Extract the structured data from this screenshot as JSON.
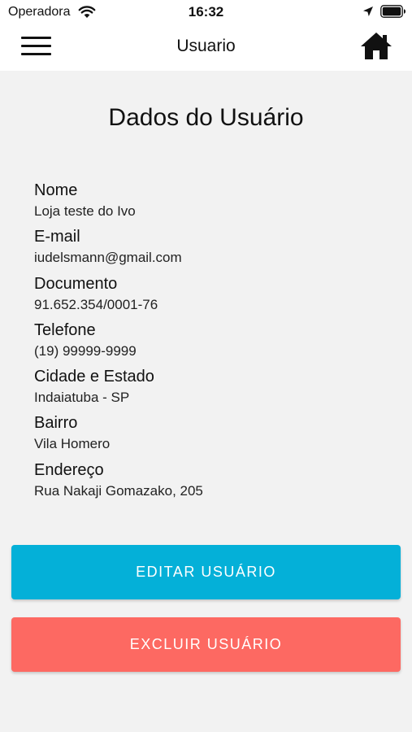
{
  "status_bar": {
    "carrier": "Operadora",
    "time": "16:32",
    "icons": [
      "wifi-icon",
      "location-arrow-icon",
      "battery-icon"
    ]
  },
  "nav": {
    "title": "Usuario",
    "menu_icon": "hamburger-menu-icon",
    "home_icon": "home-icon"
  },
  "page": {
    "title": "Dados do Usuário"
  },
  "fields": [
    {
      "label": "Nome",
      "value": "Loja teste do Ivo"
    },
    {
      "label": "E-mail",
      "value": "iudelsmann@gmail.com"
    },
    {
      "label": "Documento",
      "value": "91.652.354/0001-76"
    },
    {
      "label": "Telefone",
      "value": "(19) 99999-9999"
    },
    {
      "label": "Cidade e Estado",
      "value": "Indaiatuba - SP"
    },
    {
      "label": "Bairro",
      "value": "Vila Homero"
    },
    {
      "label": "Endereço",
      "value": "Rua Nakaji Gomazako, 205"
    }
  ],
  "actions": {
    "edit_label": "EDITAR USUÁRIO",
    "delete_label": "EXCLUIR USUÁRIO"
  },
  "colors": {
    "edit_button": "#04b0d8",
    "delete_button": "#fd6962",
    "background": "#f2f2f2",
    "header": "#ffffff"
  }
}
